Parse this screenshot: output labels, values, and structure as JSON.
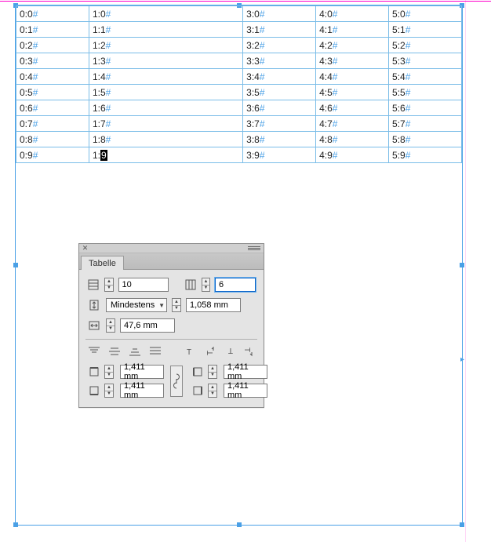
{
  "table": {
    "rows": [
      [
        {
          "t": "0:0",
          "h": "#"
        },
        {
          "t": "1:0",
          "h": "#"
        },
        {
          "t": "3:0",
          "h": "#"
        },
        {
          "t": "4:0",
          "h": "#"
        },
        {
          "t": "5:0",
          "h": "#"
        }
      ],
      [
        {
          "t": "0:1",
          "h": "#"
        },
        {
          "t": "1:1",
          "h": "#"
        },
        {
          "t": "3:1",
          "h": "#"
        },
        {
          "t": "4:1",
          "h": "#"
        },
        {
          "t": "5:1",
          "h": "#"
        }
      ],
      [
        {
          "t": "0:2",
          "h": "#"
        },
        {
          "t": "1:2",
          "h": "#"
        },
        {
          "t": "3:2",
          "h": "#"
        },
        {
          "t": "4:2",
          "h": "#"
        },
        {
          "t": "5:2",
          "h": "#"
        }
      ],
      [
        {
          "t": "0:3",
          "h": "#"
        },
        {
          "t": "1:3",
          "h": "#"
        },
        {
          "t": "3:3",
          "h": "#"
        },
        {
          "t": "4:3",
          "h": "#"
        },
        {
          "t": "5:3",
          "h": "#"
        }
      ],
      [
        {
          "t": "0:4",
          "h": "#"
        },
        {
          "t": "1:4",
          "h": "#"
        },
        {
          "t": "3:4",
          "h": "#"
        },
        {
          "t": "4:4",
          "h": "#"
        },
        {
          "t": "5:4",
          "h": "#"
        }
      ],
      [
        {
          "t": "0:5",
          "h": "#"
        },
        {
          "t": "1:5",
          "h": "#"
        },
        {
          "t": "3:5",
          "h": "#"
        },
        {
          "t": "4:5",
          "h": "#"
        },
        {
          "t": "5:5",
          "h": "#"
        }
      ],
      [
        {
          "t": "0:6",
          "h": "#"
        },
        {
          "t": "1:6",
          "h": "#"
        },
        {
          "t": "3:6",
          "h": "#"
        },
        {
          "t": "4:6",
          "h": "#"
        },
        {
          "t": "5:6",
          "h": "#"
        }
      ],
      [
        {
          "t": "0:7",
          "h": "#"
        },
        {
          "t": "1:7",
          "h": "#"
        },
        {
          "t": "3:7",
          "h": "#"
        },
        {
          "t": "4:7",
          "h": "#"
        },
        {
          "t": "5:7",
          "h": "#"
        }
      ],
      [
        {
          "t": "0:8",
          "h": "#"
        },
        {
          "t": "1:8",
          "h": "#"
        },
        {
          "t": "3:8",
          "h": "#"
        },
        {
          "t": "4:8",
          "h": "#"
        },
        {
          "t": "5:8",
          "h": "#"
        }
      ],
      [
        {
          "t": "0:9",
          "h": "#"
        },
        {
          "t": "1:",
          "sel": "9",
          "h": ""
        },
        {
          "t": "3:9",
          "h": "#"
        },
        {
          "t": "4:9",
          "h": "#"
        },
        {
          "t": "5:9",
          "h": "#"
        }
      ]
    ]
  },
  "panel": {
    "title": "Tabelle",
    "rows_value": "10",
    "cols_value": "6",
    "row_height_mode": "Mindestens",
    "row_height_value": "1,058 mm",
    "col_width_value": "47,6 mm",
    "inset_top": "1,411 mm",
    "inset_bottom": "1,411 mm",
    "inset_left": "1,411 mm",
    "inset_right": "1,411 mm"
  }
}
